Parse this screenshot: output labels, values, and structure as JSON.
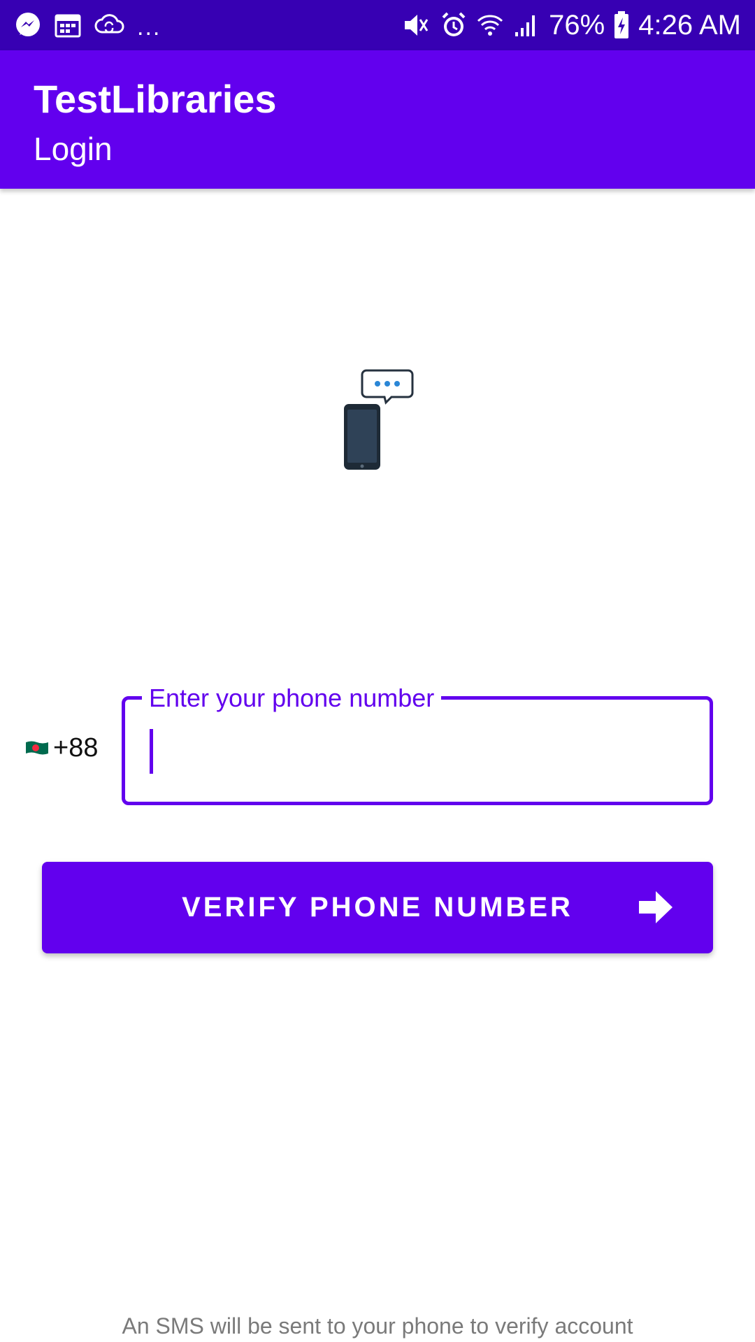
{
  "status_bar": {
    "left_icons": [
      "messenger-icon",
      "calendar-icon",
      "cloud-sync-icon"
    ],
    "more_indicator": "...",
    "right_icons": [
      "mute-icon",
      "alarm-icon",
      "wifi-icon",
      "signal-icon",
      "battery-charging-icon"
    ],
    "battery": "76%",
    "time": "4:26 AM"
  },
  "app_bar": {
    "title": "TestLibraries",
    "subtitle": "Login"
  },
  "illustration": {
    "icon": "phone-message-icon"
  },
  "phone_form": {
    "country_flag": "bangladesh-flag-icon",
    "country_code": "+88",
    "field_label": "Enter your phone number",
    "value": ""
  },
  "verify_button": {
    "label": "VERIFY PHONE NUMBER",
    "icon": "arrow-right-icon"
  },
  "footer": {
    "note": "An SMS will be sent to your phone to verify account"
  },
  "colors": {
    "status_bar": "#3700b3",
    "primary": "#6200ee",
    "footer_text": "#7a7a7a"
  }
}
